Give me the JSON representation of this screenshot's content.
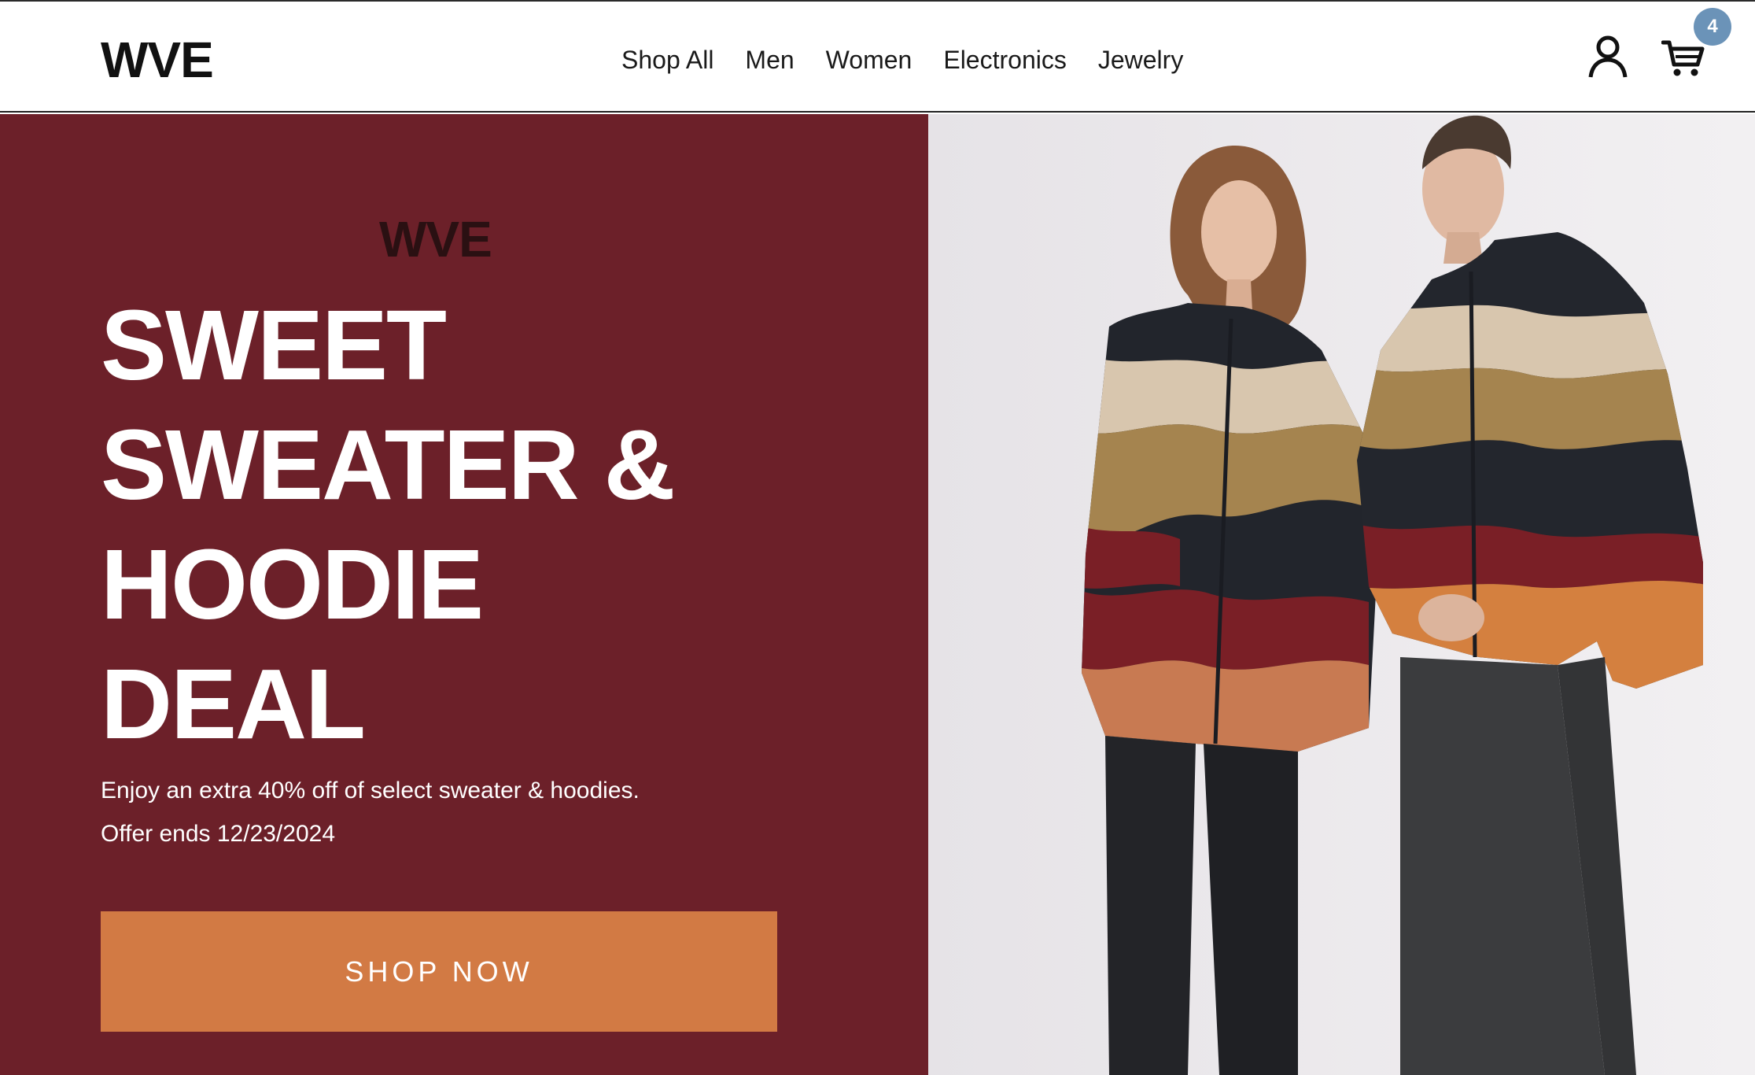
{
  "header": {
    "logo": "WVE",
    "nav": [
      "Shop All",
      "Men",
      "Women",
      "Electronics",
      "Jewelry"
    ],
    "cart_count": "4",
    "icons": {
      "account": "user-icon",
      "cart": "cart-icon"
    }
  },
  "hero": {
    "brand_mark": "WVE",
    "headline": [
      "SWEET",
      "SWEATER &",
      "HOODIE",
      "DEAL"
    ],
    "subtext": [
      "Enjoy an extra 40% off of select sweater & hoodies.",
      "Offer ends 12/23/2024"
    ],
    "cta": "SHOP NOW",
    "image_alt": "Two models wearing matching striped sherpa fleece jackets"
  },
  "colors": {
    "hero_background": "#6c2029",
    "cta_background": "#d27a44",
    "badge": "#6b93b8",
    "text_light": "#ffffff",
    "text_dark": "#111111"
  }
}
